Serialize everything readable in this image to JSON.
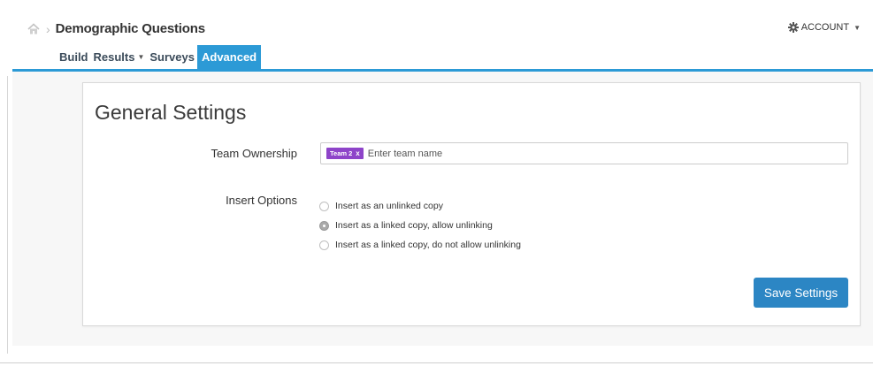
{
  "header": {
    "title": "Demographic Questions",
    "account_label": "ACCOUNT"
  },
  "tabs": [
    {
      "label": "Build",
      "active": false,
      "has_menu": false
    },
    {
      "label": "Results",
      "active": false,
      "has_menu": true
    },
    {
      "label": "Surveys",
      "active": false,
      "has_menu": false
    },
    {
      "label": "Advanced",
      "active": true,
      "has_menu": false
    }
  ],
  "settings": {
    "title": "General Settings",
    "team_ownership": {
      "label": "Team Ownership",
      "tag": "Team 2",
      "tag_remove": "x",
      "placeholder": "Enter team name"
    },
    "insert_options": {
      "label": "Insert Options",
      "options": [
        {
          "label": "Insert as an unlinked copy",
          "checked": false
        },
        {
          "label": "Insert as a linked copy, allow unlinking",
          "checked": true
        },
        {
          "label": "Insert as a linked copy, do not allow unlinking",
          "checked": false
        }
      ]
    },
    "save_label": "Save Settings"
  },
  "icons": {
    "home": "home-icon",
    "gear": "gear-icon",
    "caret": "caret-down-icon"
  },
  "colors": {
    "accent": "#2c9ad6",
    "button": "#2c86c4",
    "tag": "#8e44c9"
  }
}
